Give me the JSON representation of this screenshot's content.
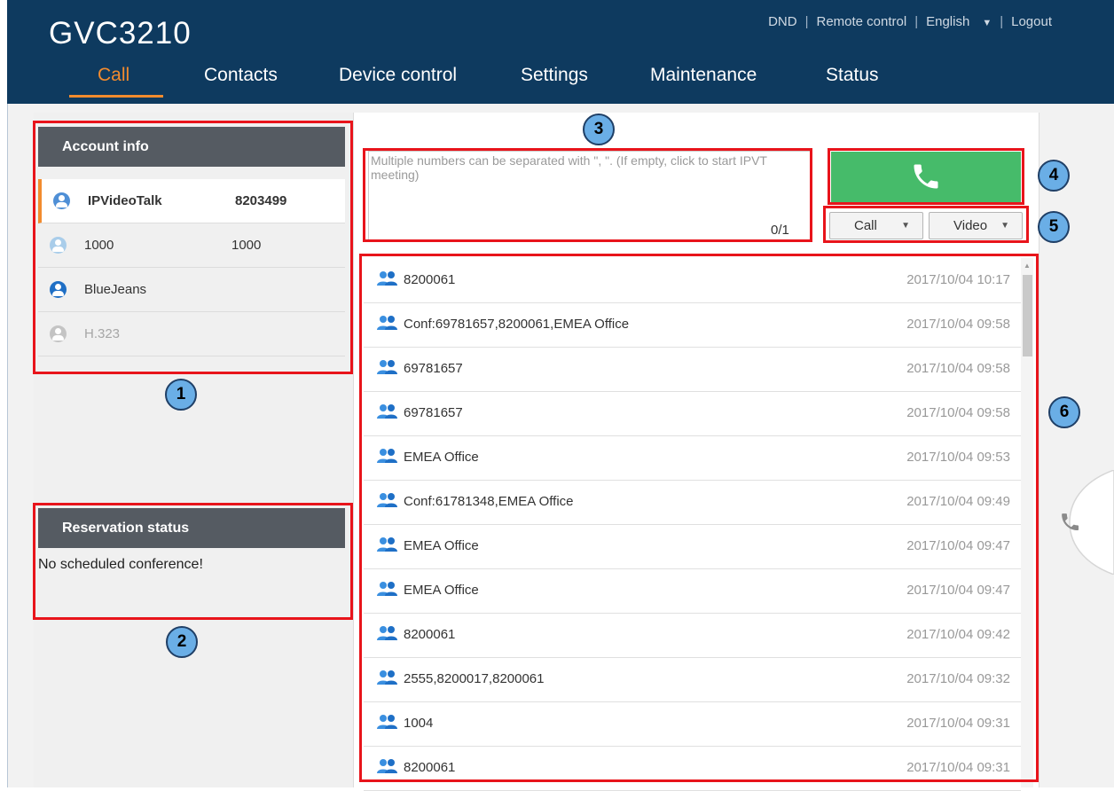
{
  "app": {
    "title": "GVC3210"
  },
  "top_links": {
    "dnd": "DND",
    "remote": "Remote control",
    "language": "English",
    "logout": "Logout"
  },
  "nav": {
    "call": "Call",
    "contacts": "Contacts",
    "device_control": "Device control",
    "settings": "Settings",
    "maintenance": "Maintenance",
    "status": "Status"
  },
  "account_info": {
    "title": "Account info",
    "accounts": [
      {
        "name": "IPVideoTalk",
        "number": "8203499",
        "icon": "user-circle-icon",
        "color": "#4f8fd6"
      },
      {
        "name": "1000",
        "number": "1000",
        "icon": "user-circle-icon",
        "color": "#a9cdea"
      },
      {
        "name": "BlueJeans",
        "number": "",
        "icon": "user-circle-icon",
        "color": "#1f6fc5"
      },
      {
        "name": "H.323",
        "number": "",
        "icon": "user-circle-icon",
        "color": "#c4c4c4"
      }
    ]
  },
  "reservation": {
    "title": "Reservation status",
    "message": "No scheduled conference!"
  },
  "dial": {
    "placeholder": "Multiple numbers can be separated with \", \". (If empty, click to start IPVT meeting)",
    "value": "",
    "counter": "0/1"
  },
  "call_button": {
    "icon": "phone-icon",
    "color": "#46bb6a"
  },
  "dropdowns": {
    "call": "Call",
    "video": "Video"
  },
  "history": [
    {
      "name": "8200061",
      "time": "2017/10/04 10:17"
    },
    {
      "name": "Conf:69781657,8200061,EMEA Office",
      "time": "2017/10/04 09:58"
    },
    {
      "name": "69781657",
      "time": "2017/10/04 09:58"
    },
    {
      "name": "69781657",
      "time": "2017/10/04 09:58"
    },
    {
      "name": "EMEA Office",
      "time": "2017/10/04 09:53"
    },
    {
      "name": "Conf:61781348,EMEA Office",
      "time": "2017/10/04 09:49"
    },
    {
      "name": "EMEA Office",
      "time": "2017/10/04 09:47"
    },
    {
      "name": "EMEA Office",
      "time": "2017/10/04 09:47"
    },
    {
      "name": "8200061",
      "time": "2017/10/04 09:42"
    },
    {
      "name": "2555,8200017,8200061",
      "time": "2017/10/04 09:32"
    },
    {
      "name": "1004",
      "time": "2017/10/04 09:31"
    },
    {
      "name": "8200061",
      "time": "2017/10/04 09:31"
    }
  ],
  "callouts": [
    "1",
    "2",
    "3",
    "4",
    "5",
    "6"
  ],
  "colors": {
    "header": "#0e3a5f",
    "accent": "#f28b2e",
    "annotation": "#e8141b",
    "callout": "#6aaee6"
  }
}
